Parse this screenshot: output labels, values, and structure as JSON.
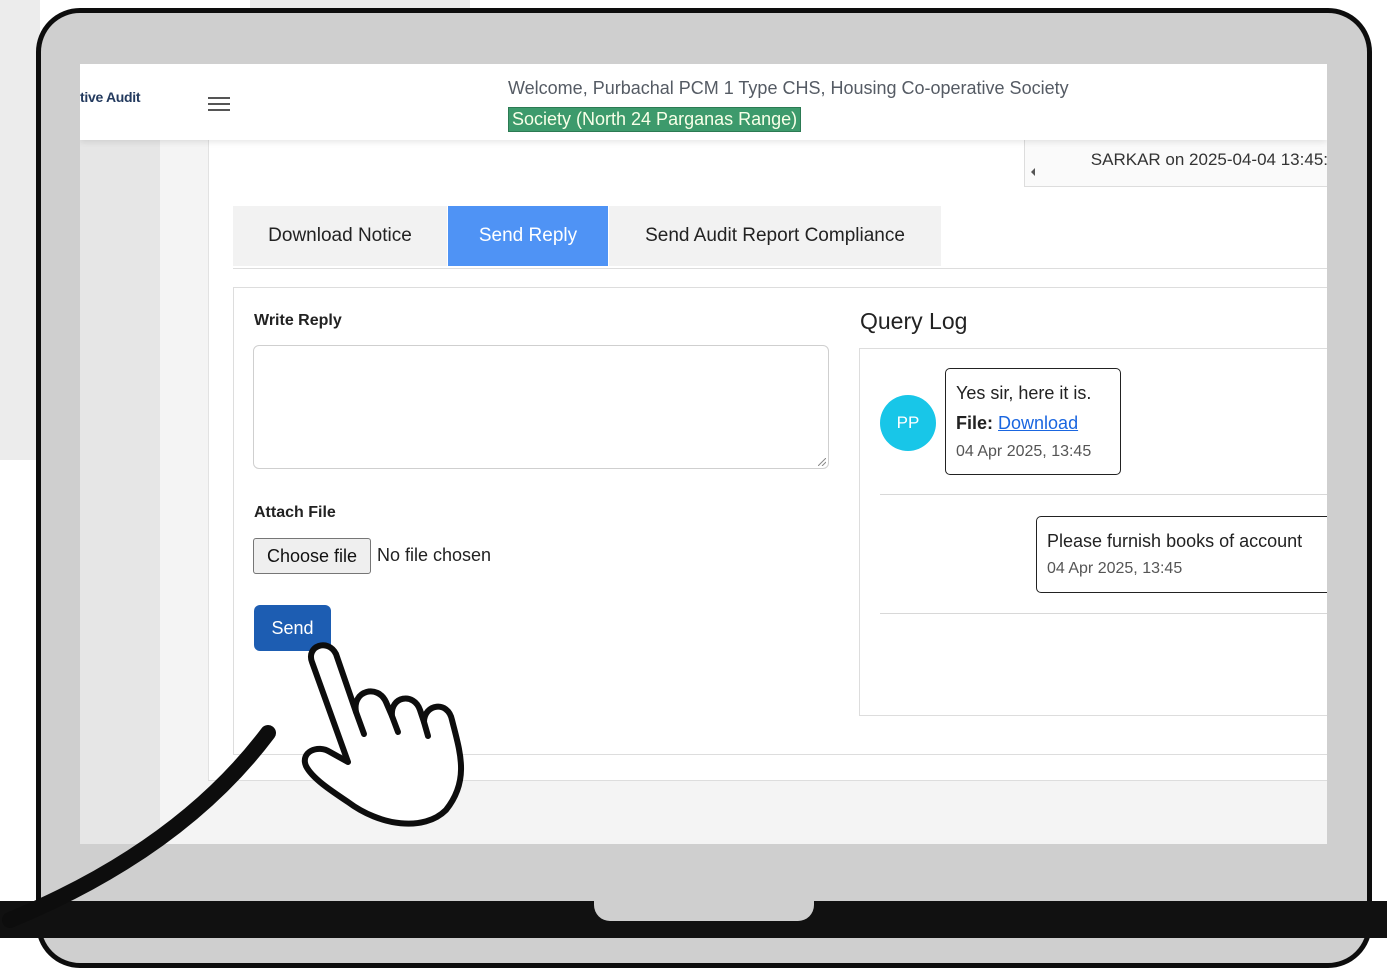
{
  "header": {
    "brand": "tive Audit",
    "welcome": "Welcome,  Purbachal PCM 1 Type CHS,  Housing Co-operative Society",
    "range_badge": "Society (North 24 Parganas Range)"
  },
  "log_entry_preview": "SARKAR on 2025-04-04 13:45:",
  "tabs": [
    {
      "label": "Download Notice",
      "active": false
    },
    {
      "label": "Send Reply",
      "active": true
    },
    {
      "label": "Send Audit Report Compliance",
      "active": false
    }
  ],
  "reply_form": {
    "write_reply_label": "Write Reply",
    "reply_value": "",
    "attach_label": "Attach File",
    "choose_file_label": "Choose file",
    "no_file_text": "No file chosen",
    "send_label": "Send"
  },
  "query_log": {
    "title": "Query Log",
    "messages": [
      {
        "avatar": "PP",
        "text": "Yes sir, here it is.",
        "file_label": "File:",
        "file_link": "Download",
        "time": "04 Apr 2025, 13:45"
      },
      {
        "text": "Please furnish books of account",
        "time": "04 Apr 2025, 13:45"
      }
    ]
  },
  "colors": {
    "active_tab": "#4f93f5",
    "send_button": "#1d5db2",
    "badge": "#3d9a6c",
    "avatar": "#18c6e8"
  },
  "icons": [
    "hamburger-menu-icon",
    "pointing-hand-icon"
  ]
}
